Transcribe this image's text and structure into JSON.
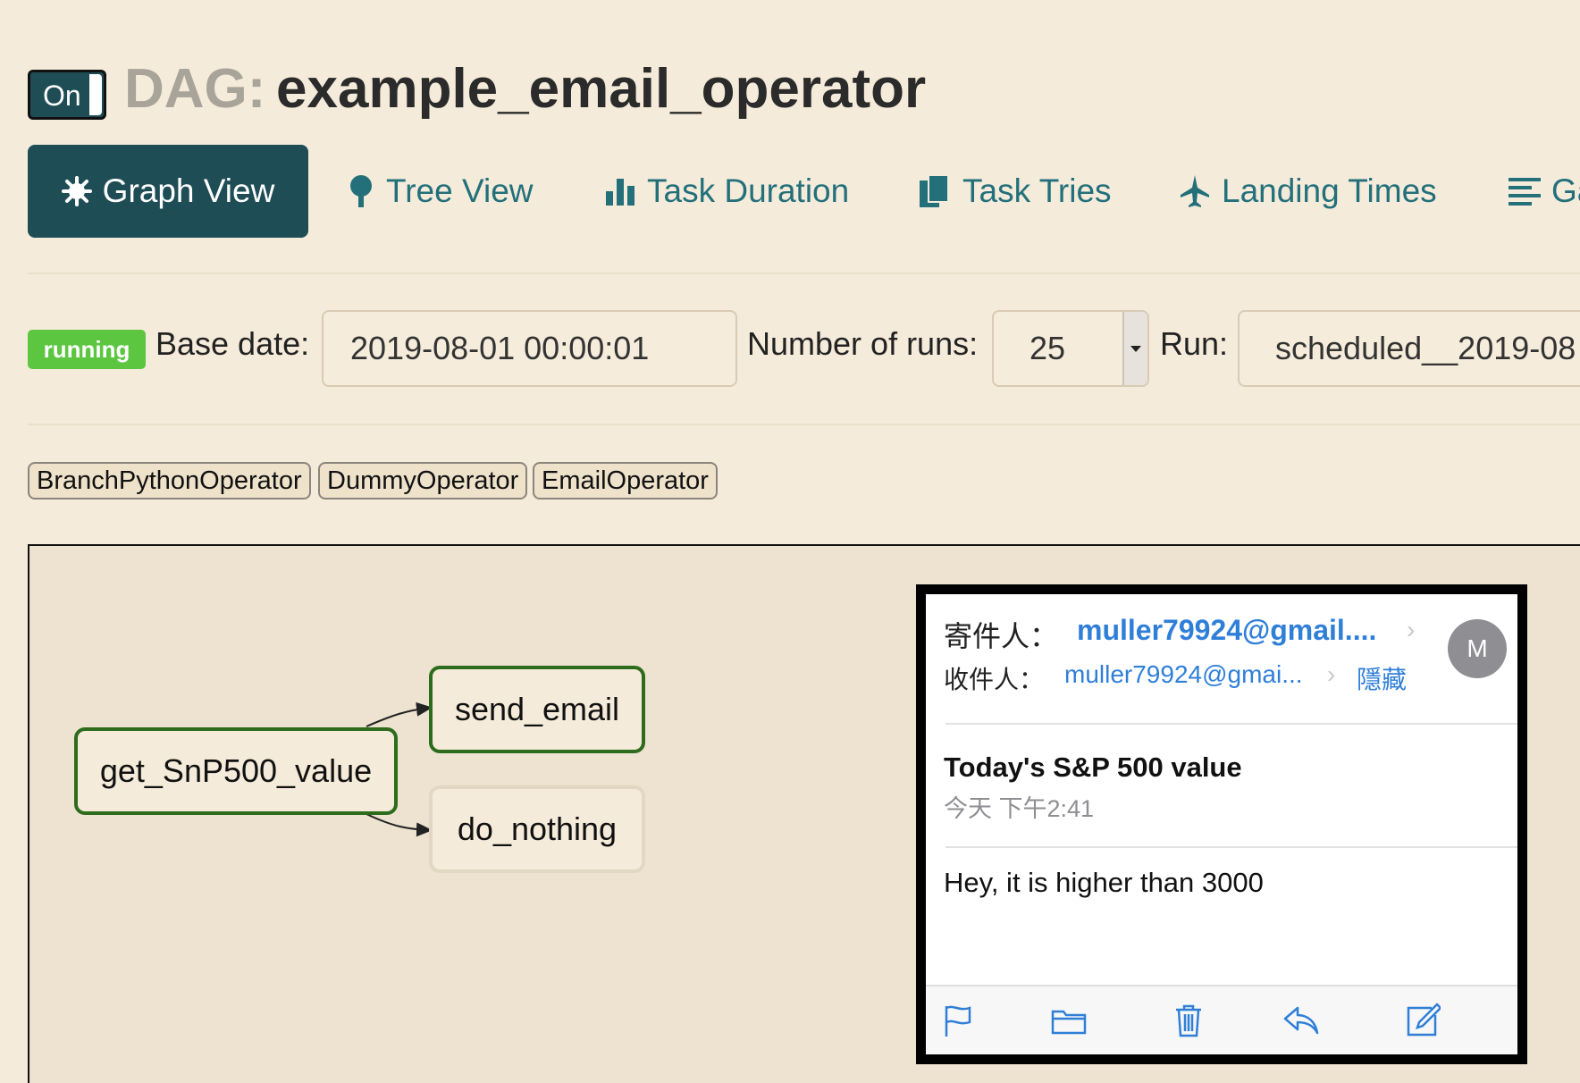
{
  "header": {
    "toggle_label": "On",
    "title_prefix": "DAG:",
    "dag_name": "example_email_operator"
  },
  "tabs": [
    {
      "label": "Graph View",
      "icon": "snowflake-icon",
      "active": true
    },
    {
      "label": "Tree View",
      "icon": "tree-icon"
    },
    {
      "label": "Task Duration",
      "icon": "bar-chart-icon"
    },
    {
      "label": "Task Tries",
      "icon": "files-icon"
    },
    {
      "label": "Landing Times",
      "icon": "plane-icon"
    },
    {
      "label": "Ga",
      "icon": "list-icon"
    }
  ],
  "controls": {
    "state_badge": "running",
    "base_date_label": "Base date:",
    "base_date_value": "2019-08-01 00:00:01",
    "num_runs_label": "Number of runs:",
    "num_runs_value": "25",
    "run_label": "Run:",
    "run_value": "scheduled__2019-08"
  },
  "operators": [
    "BranchPythonOperator",
    "DummyOperator",
    "EmailOperator"
  ],
  "graph": {
    "nodes": [
      {
        "id": "get_SnP500_value",
        "status": "success"
      },
      {
        "id": "send_email",
        "status": "success"
      },
      {
        "id": "do_nothing",
        "status": "none"
      }
    ],
    "edges": [
      {
        "from": "get_SnP500_value",
        "to": "send_email"
      },
      {
        "from": "get_SnP500_value",
        "to": "do_nothing"
      }
    ]
  },
  "email": {
    "from_label": "寄件人：",
    "from_value": "muller79924@gmail....",
    "to_label": "收件人：",
    "to_value": "muller79924@gmai...",
    "hide_label": "隱藏",
    "avatar_letter": "M",
    "subject": "Today's S&P 500 value",
    "time": "今天 下午2:41",
    "body": "Hey, it is higher than 3000",
    "toolbar_icons": [
      "flag-icon",
      "folder-icon",
      "trash-icon",
      "reply-icon",
      "compose-icon"
    ]
  },
  "colors": {
    "page_bg": "#f5ebda",
    "active_tab": "#1e4d56",
    "link": "#23707b",
    "running": "#5cc641",
    "success_border": "#2e6c1d",
    "ios_blue": "#2f7fd8"
  }
}
